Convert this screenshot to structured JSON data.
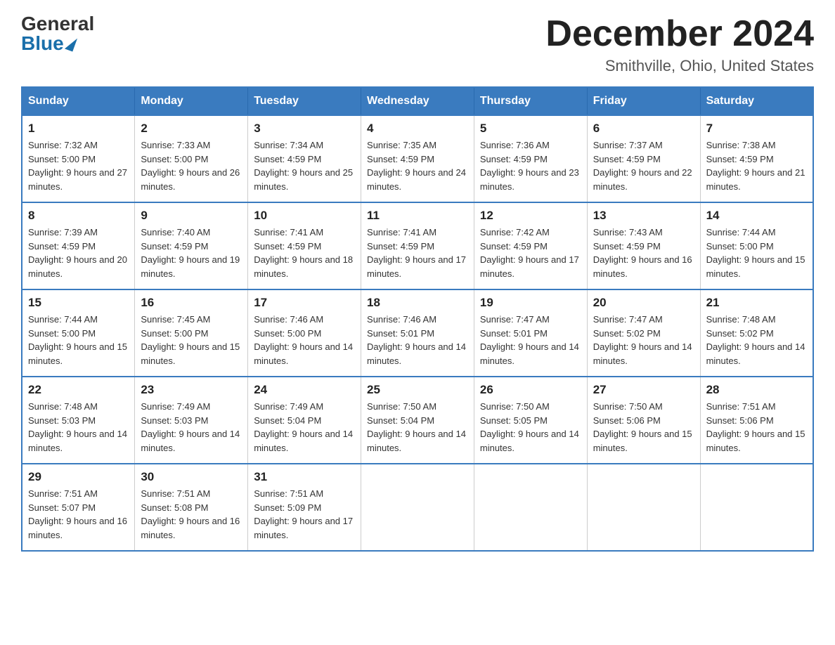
{
  "header": {
    "logo_general": "General",
    "logo_blue": "Blue",
    "month_title": "December 2024",
    "subtitle": "Smithville, Ohio, United States"
  },
  "days_of_week": [
    "Sunday",
    "Monday",
    "Tuesday",
    "Wednesday",
    "Thursday",
    "Friday",
    "Saturday"
  ],
  "weeks": [
    [
      {
        "day": "1",
        "sunrise": "7:32 AM",
        "sunset": "5:00 PM",
        "daylight": "9 hours and 27 minutes."
      },
      {
        "day": "2",
        "sunrise": "7:33 AM",
        "sunset": "5:00 PM",
        "daylight": "9 hours and 26 minutes."
      },
      {
        "day": "3",
        "sunrise": "7:34 AM",
        "sunset": "4:59 PM",
        "daylight": "9 hours and 25 minutes."
      },
      {
        "day": "4",
        "sunrise": "7:35 AM",
        "sunset": "4:59 PM",
        "daylight": "9 hours and 24 minutes."
      },
      {
        "day": "5",
        "sunrise": "7:36 AM",
        "sunset": "4:59 PM",
        "daylight": "9 hours and 23 minutes."
      },
      {
        "day": "6",
        "sunrise": "7:37 AM",
        "sunset": "4:59 PM",
        "daylight": "9 hours and 22 minutes."
      },
      {
        "day": "7",
        "sunrise": "7:38 AM",
        "sunset": "4:59 PM",
        "daylight": "9 hours and 21 minutes."
      }
    ],
    [
      {
        "day": "8",
        "sunrise": "7:39 AM",
        "sunset": "4:59 PM",
        "daylight": "9 hours and 20 minutes."
      },
      {
        "day": "9",
        "sunrise": "7:40 AM",
        "sunset": "4:59 PM",
        "daylight": "9 hours and 19 minutes."
      },
      {
        "day": "10",
        "sunrise": "7:41 AM",
        "sunset": "4:59 PM",
        "daylight": "9 hours and 18 minutes."
      },
      {
        "day": "11",
        "sunrise": "7:41 AM",
        "sunset": "4:59 PM",
        "daylight": "9 hours and 17 minutes."
      },
      {
        "day": "12",
        "sunrise": "7:42 AM",
        "sunset": "4:59 PM",
        "daylight": "9 hours and 17 minutes."
      },
      {
        "day": "13",
        "sunrise": "7:43 AM",
        "sunset": "4:59 PM",
        "daylight": "9 hours and 16 minutes."
      },
      {
        "day": "14",
        "sunrise": "7:44 AM",
        "sunset": "5:00 PM",
        "daylight": "9 hours and 15 minutes."
      }
    ],
    [
      {
        "day": "15",
        "sunrise": "7:44 AM",
        "sunset": "5:00 PM",
        "daylight": "9 hours and 15 minutes."
      },
      {
        "day": "16",
        "sunrise": "7:45 AM",
        "sunset": "5:00 PM",
        "daylight": "9 hours and 15 minutes."
      },
      {
        "day": "17",
        "sunrise": "7:46 AM",
        "sunset": "5:00 PM",
        "daylight": "9 hours and 14 minutes."
      },
      {
        "day": "18",
        "sunrise": "7:46 AM",
        "sunset": "5:01 PM",
        "daylight": "9 hours and 14 minutes."
      },
      {
        "day": "19",
        "sunrise": "7:47 AM",
        "sunset": "5:01 PM",
        "daylight": "9 hours and 14 minutes."
      },
      {
        "day": "20",
        "sunrise": "7:47 AM",
        "sunset": "5:02 PM",
        "daylight": "9 hours and 14 minutes."
      },
      {
        "day": "21",
        "sunrise": "7:48 AM",
        "sunset": "5:02 PM",
        "daylight": "9 hours and 14 minutes."
      }
    ],
    [
      {
        "day": "22",
        "sunrise": "7:48 AM",
        "sunset": "5:03 PM",
        "daylight": "9 hours and 14 minutes."
      },
      {
        "day": "23",
        "sunrise": "7:49 AM",
        "sunset": "5:03 PM",
        "daylight": "9 hours and 14 minutes."
      },
      {
        "day": "24",
        "sunrise": "7:49 AM",
        "sunset": "5:04 PM",
        "daylight": "9 hours and 14 minutes."
      },
      {
        "day": "25",
        "sunrise": "7:50 AM",
        "sunset": "5:04 PM",
        "daylight": "9 hours and 14 minutes."
      },
      {
        "day": "26",
        "sunrise": "7:50 AM",
        "sunset": "5:05 PM",
        "daylight": "9 hours and 14 minutes."
      },
      {
        "day": "27",
        "sunrise": "7:50 AM",
        "sunset": "5:06 PM",
        "daylight": "9 hours and 15 minutes."
      },
      {
        "day": "28",
        "sunrise": "7:51 AM",
        "sunset": "5:06 PM",
        "daylight": "9 hours and 15 minutes."
      }
    ],
    [
      {
        "day": "29",
        "sunrise": "7:51 AM",
        "sunset": "5:07 PM",
        "daylight": "9 hours and 16 minutes."
      },
      {
        "day": "30",
        "sunrise": "7:51 AM",
        "sunset": "5:08 PM",
        "daylight": "9 hours and 16 minutes."
      },
      {
        "day": "31",
        "sunrise": "7:51 AM",
        "sunset": "5:09 PM",
        "daylight": "9 hours and 17 minutes."
      },
      null,
      null,
      null,
      null
    ]
  ]
}
